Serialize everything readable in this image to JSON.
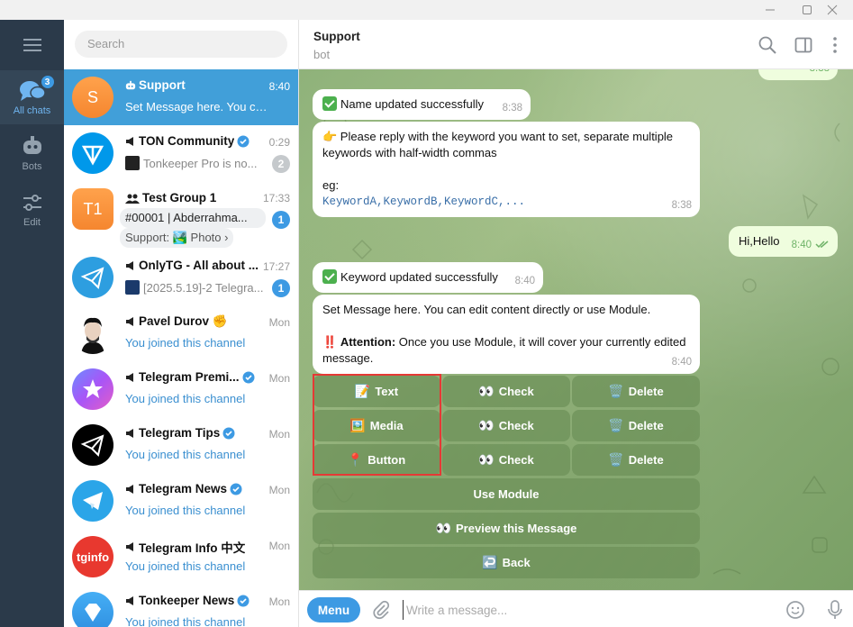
{
  "window": {
    "controls": [
      "minimize-icon",
      "maximize-icon",
      "close-icon"
    ]
  },
  "rail": {
    "items": [
      {
        "label": "All chats",
        "badge": "3",
        "icon": "chat-bubbles-icon"
      },
      {
        "label": "Bots",
        "icon": "robot-icon"
      },
      {
        "label": "Edit",
        "icon": "sliders-icon"
      }
    ]
  },
  "search": {
    "placeholder": "Search"
  },
  "chats": [
    {
      "name": "Support",
      "time": "8:40",
      "preview": "Set Message here. You can e...",
      "avatar": "S",
      "avatar_color": "#f5922f",
      "icon": "bot-icon"
    },
    {
      "name": "TON Community",
      "time": "0:29",
      "preview": "Tonkeeper Pro is no...",
      "count": "2",
      "icon": "speaker-icon",
      "verified": true
    },
    {
      "name": "Test Group 1",
      "time": "17:33",
      "preview": "#00001 | Abderrahma...",
      "preview2": "Support: 🏞️ Photo ›",
      "count": "1",
      "avatar": "T1",
      "avatar_color": "#f5922f",
      "icon": "group-icon"
    },
    {
      "name": "OnlyTG - All about ...",
      "time": "17:27",
      "preview": "[2025.5.19]-2 Telegra...",
      "count": "1",
      "icon": "speaker-icon"
    },
    {
      "name": "Pavel Durov ✊",
      "time": "Mon",
      "preview": "You joined this channel",
      "icon": "speaker-icon"
    },
    {
      "name": "Telegram Premi...",
      "time": "Mon",
      "preview": "You joined this channel",
      "icon": "speaker-icon",
      "verified": true
    },
    {
      "name": "Telegram Tips",
      "time": "Mon",
      "preview": "You joined this channel",
      "icon": "speaker-icon",
      "verified": true
    },
    {
      "name": "Telegram News",
      "time": "Mon",
      "preview": "You joined this channel",
      "icon": "speaker-icon",
      "verified": true
    },
    {
      "name": "Telegram Info 中文",
      "time": "Mon",
      "preview": "You joined this channel",
      "icon": "speaker-icon"
    },
    {
      "name": "Tonkeeper News",
      "time": "Mon",
      "preview": "You joined this channel",
      "icon": "speaker-icon",
      "verified": true
    }
  ],
  "header": {
    "title": "Support",
    "subtitle": "bot"
  },
  "messages": {
    "top_partial_time": "8:38",
    "m1": {
      "text": "Name updated successfully",
      "time": "8:38"
    },
    "m2": {
      "line1": "👉 Please reply with the keyword you want to set, separate multiple keywords with half-width commas",
      "line2": "eg:",
      "code": "KeywordA,KeywordB,KeywordC,...",
      "time": "8:38"
    },
    "m3": {
      "text": "Hi,Hello",
      "time": "8:40"
    },
    "m4": {
      "text": "Keyword updated successfully",
      "time": "8:40"
    },
    "m5": {
      "line1": "Set Message here. You can edit content directly or use Module.",
      "attention_label": "Attention:",
      "attention_text": " Once you use Module, it will cover your currently edited message.",
      "time": "8:40"
    }
  },
  "keyboard": {
    "rows": [
      [
        {
          "label": "Text",
          "emoji": "📝"
        },
        {
          "label": "Check",
          "emoji": "👀"
        },
        {
          "label": "Delete",
          "emoji": "🗑️"
        }
      ],
      [
        {
          "label": "Media",
          "emoji": "🖼️"
        },
        {
          "label": "Check",
          "emoji": "👀"
        },
        {
          "label": "Delete",
          "emoji": "🗑️"
        }
      ],
      [
        {
          "label": "Button",
          "emoji": "📍"
        },
        {
          "label": "Check",
          "emoji": "👀"
        },
        {
          "label": "Delete",
          "emoji": "🗑️"
        }
      ]
    ],
    "use_module": "Use Module",
    "preview": "Preview this Message",
    "preview_emoji": "👀",
    "back": "Back",
    "back_emoji": "↩️"
  },
  "composer": {
    "menu": "Menu",
    "placeholder": "Write a message..."
  },
  "colors": {
    "accent": "#419fd9",
    "rail": "#2b3a4a",
    "keyboard_button": "#6e915a",
    "highlight_box": "#e53935"
  }
}
